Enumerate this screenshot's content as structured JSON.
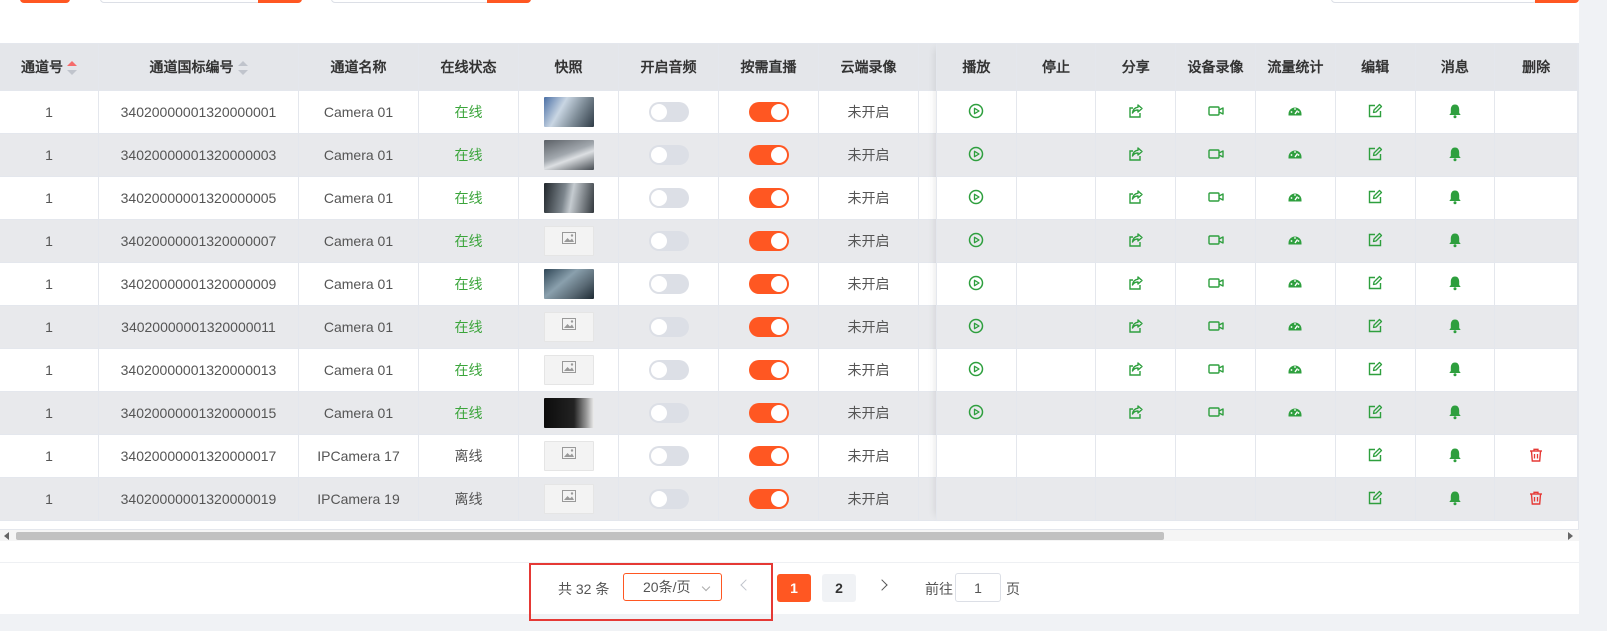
{
  "table": {
    "headers": {
      "channel_no": "通道号",
      "gb_code": "通道国标编号",
      "name": "通道名称",
      "status": "在线状态",
      "snapshot": "快照",
      "audio": "开启音频",
      "on_demand": "按需直播",
      "cloud_record": "云端录像",
      "play": "播放",
      "stop": "停止",
      "share": "分享",
      "device_record": "设备录像",
      "traffic": "流量统计",
      "edit": "编辑",
      "message": "消息",
      "delete": "删除"
    },
    "rows": [
      {
        "channel_no": "1",
        "gb_code": "34020000001320000001",
        "name": "Camera 01",
        "status": "在线",
        "online": true,
        "snapshot": "real",
        "audio_on": false,
        "on_demand_on": true,
        "cloud_record": "未开启"
      },
      {
        "channel_no": "1",
        "gb_code": "34020000001320000003",
        "name": "Camera 01",
        "status": "在线",
        "online": true,
        "snapshot": "real",
        "audio_on": false,
        "on_demand_on": true,
        "cloud_record": "未开启"
      },
      {
        "channel_no": "1",
        "gb_code": "34020000001320000005",
        "name": "Camera 01",
        "status": "在线",
        "online": true,
        "snapshot": "real",
        "audio_on": false,
        "on_demand_on": true,
        "cloud_record": "未开启"
      },
      {
        "channel_no": "1",
        "gb_code": "34020000001320000007",
        "name": "Camera 01",
        "status": "在线",
        "online": true,
        "snapshot": "placeholder",
        "audio_on": false,
        "on_demand_on": true,
        "cloud_record": "未开启"
      },
      {
        "channel_no": "1",
        "gb_code": "34020000001320000009",
        "name": "Camera 01",
        "status": "在线",
        "online": true,
        "snapshot": "real",
        "audio_on": false,
        "on_demand_on": true,
        "cloud_record": "未开启"
      },
      {
        "channel_no": "1",
        "gb_code": "34020000001320000011",
        "name": "Camera 01",
        "status": "在线",
        "online": true,
        "snapshot": "placeholder",
        "audio_on": false,
        "on_demand_on": true,
        "cloud_record": "未开启"
      },
      {
        "channel_no": "1",
        "gb_code": "34020000001320000013",
        "name": "Camera 01",
        "status": "在线",
        "online": true,
        "snapshot": "placeholder",
        "audio_on": false,
        "on_demand_on": true,
        "cloud_record": "未开启"
      },
      {
        "channel_no": "1",
        "gb_code": "34020000001320000015",
        "name": "Camera 01",
        "status": "在线",
        "online": true,
        "snapshot": "real",
        "audio_on": false,
        "on_demand_on": true,
        "cloud_record": "未开启"
      },
      {
        "channel_no": "1",
        "gb_code": "34020000001320000017",
        "name": "IPCamera 17",
        "status": "离线",
        "online": false,
        "snapshot": "placeholder",
        "audio_on": false,
        "on_demand_on": true,
        "cloud_record": "未开启"
      },
      {
        "channel_no": "1",
        "gb_code": "34020000001320000019",
        "name": "IPCamera 19",
        "status": "离线",
        "online": false,
        "snapshot": "placeholder",
        "audio_on": false,
        "on_demand_on": true,
        "cloud_record": "未开启"
      }
    ]
  },
  "icons": {
    "play": "play-circle-icon",
    "share": "share-icon",
    "device_record": "video-camera-icon",
    "traffic": "speedometer-icon",
    "edit": "edit-icon",
    "message": "bell-icon",
    "delete": "trash-icon"
  },
  "colors": {
    "accent": "#ff5722",
    "online": "#3ba53b",
    "icon_green": "#2e9f3e",
    "delete_red": "#e53935"
  },
  "pagination": {
    "total_label": "共 32 条",
    "page_size": "20条/页",
    "pages": [
      "1",
      "2"
    ],
    "current_page": "1",
    "goto_label": "前往",
    "goto_value": "1",
    "goto_suffix": "页"
  }
}
